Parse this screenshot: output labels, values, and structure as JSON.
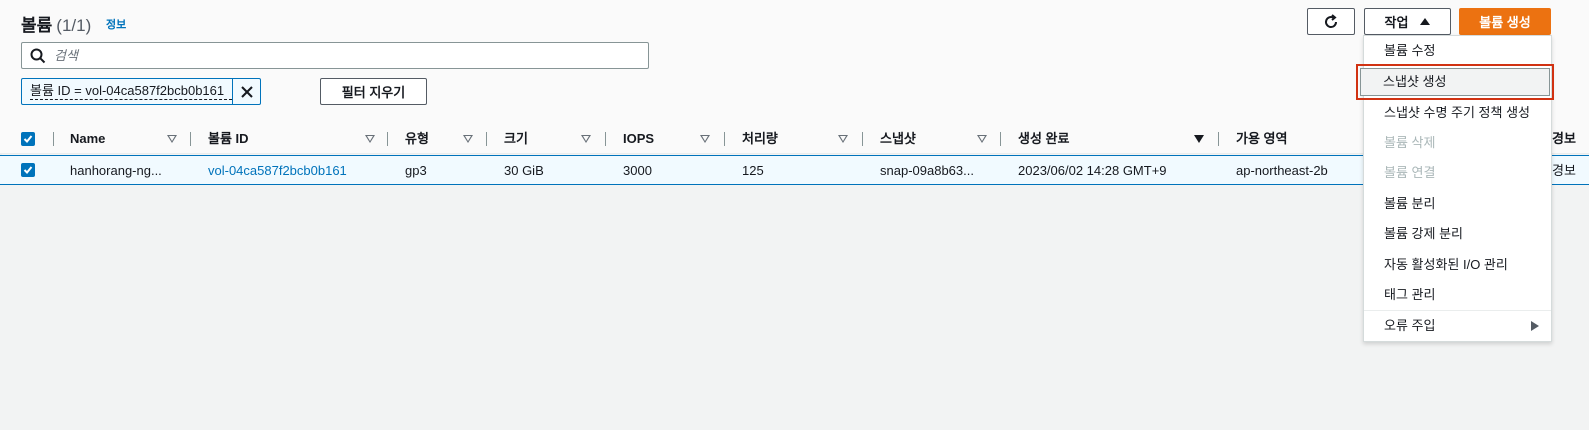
{
  "header": {
    "title": "볼륨",
    "count": "(1/1)",
    "info_link": "정보"
  },
  "search": {
    "placeholder": "검색"
  },
  "filter_token": {
    "label": "볼륨 ID = vol-04ca587f2bcb0b161"
  },
  "buttons": {
    "clear_filters": "필터 지우기",
    "actions": "작업",
    "create_volume": "볼륨 생성"
  },
  "table": {
    "columns": [
      "Name",
      "볼륨 ID",
      "유형",
      "크기",
      "IOPS",
      "처리량",
      "스냅샷",
      "생성 완료",
      "가용 영역",
      "경보"
    ],
    "rows": [
      {
        "name": "hanhorang-ng...",
        "volume_id": "vol-04ca587f2bcb0b161",
        "type": "gp3",
        "size": "30 GiB",
        "iops": "3000",
        "throughput": "125",
        "snapshot": "snap-09a8b63...",
        "created": "2023/06/02 14:28 GMT+9",
        "az": "ap-northeast-2b",
        "alarm": "경보"
      }
    ]
  },
  "actions_menu": {
    "items": [
      {
        "label": "볼륨 수정",
        "disabled": false
      },
      {
        "label": "스냅샷 생성",
        "disabled": false,
        "highlighted": true
      },
      {
        "label": "스냅샷 수명 주기 정책 생성",
        "disabled": false
      },
      {
        "label": "볼륨 삭제",
        "disabled": true
      },
      {
        "label": "볼륨 연결",
        "disabled": true
      },
      {
        "label": "볼륨 분리",
        "disabled": false
      },
      {
        "label": "볼륨 강제 분리",
        "disabled": false
      },
      {
        "label": "자동 활성화된 I/O 관리",
        "disabled": false
      },
      {
        "label": "태그 관리",
        "disabled": false
      },
      {
        "label": "오류 주입",
        "disabled": false,
        "submenu": true
      }
    ]
  },
  "colors": {
    "accent": "#0073bb",
    "primary_button": "#ec7211",
    "highlight_border": "#d13212"
  }
}
